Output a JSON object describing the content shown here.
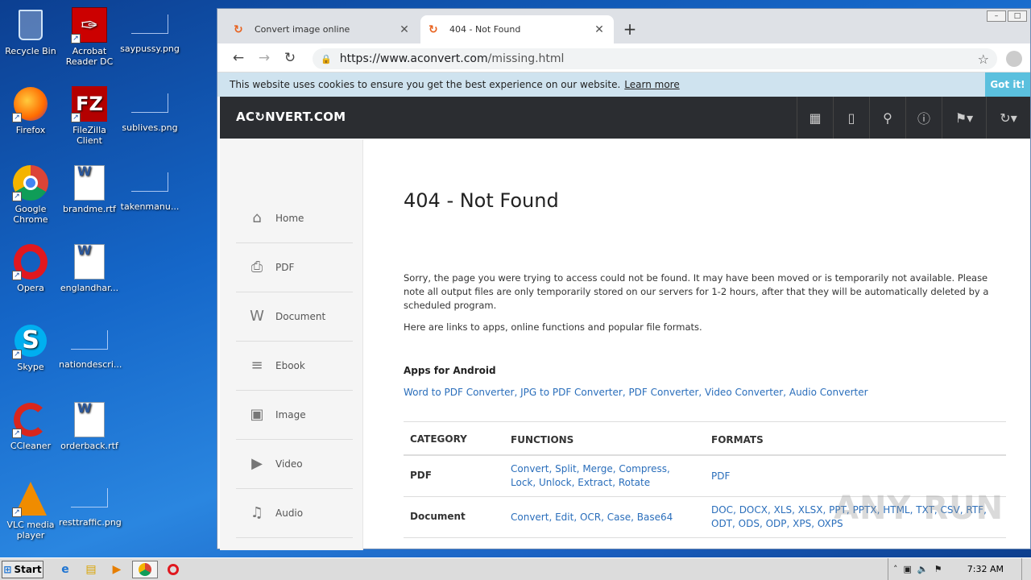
{
  "desktop": {
    "icons": [
      {
        "label": "Recycle Bin"
      },
      {
        "label": "Acrobat Reader DC"
      },
      {
        "label": "saypussy.png"
      },
      {
        "label": "Firefox"
      },
      {
        "label": "FileZilla Client"
      },
      {
        "label": "sublives.png"
      },
      {
        "label": "Google Chrome"
      },
      {
        "label": "brandme.rtf"
      },
      {
        "label": "takenmanu..."
      },
      {
        "label": "Opera"
      },
      {
        "label": "englandhar..."
      },
      {
        "label": "Skype"
      },
      {
        "label": "nationdescri..."
      },
      {
        "label": "CCleaner"
      },
      {
        "label": "orderback.rtf"
      },
      {
        "label": "VLC media player"
      },
      {
        "label": "resttraffic.png"
      }
    ]
  },
  "browser": {
    "tabs": [
      {
        "title": "Convert image online"
      },
      {
        "title": "404 - Not Found"
      }
    ],
    "url_domain": "https://www.aconvert.com",
    "url_path": "/missing.html"
  },
  "cookie_bar": {
    "text": "This website uses cookies to ensure you get the best experience on our website.",
    "learn_more": "Learn more",
    "button": "Got it!"
  },
  "site": {
    "logo": "AC↻NVERT.COM",
    "sidebar": [
      {
        "label": "Home",
        "icon": "⌂"
      },
      {
        "label": "PDF",
        "icon": "⎙"
      },
      {
        "label": "Document",
        "icon": "W"
      },
      {
        "label": "Ebook",
        "icon": "≡"
      },
      {
        "label": "Image",
        "icon": "▣"
      },
      {
        "label": "Video",
        "icon": "▶"
      },
      {
        "label": "Audio",
        "icon": "♫"
      }
    ],
    "page_title": "404 - Not Found",
    "intro": "Sorry, the page you were trying to access could not be found. It may have been moved or is temporarily not available. Please note all output files are only temporarily stored on our servers for 1-2 hours, after that they will be automatically deleted by a scheduled program.",
    "links_intro": "Here are links to apps, online functions and popular file formats.",
    "apps_heading": "Apps for Android",
    "apps_links": "Word to PDF Converter, JPG to PDF Converter, PDF Converter, Video Converter, Audio Converter",
    "table": {
      "headers": [
        "CATEGORY",
        "FUNCTIONS",
        "FORMATS"
      ],
      "rows": [
        {
          "category": "PDF",
          "functions": "Convert, Split, Merge, Compress, Lock, Unlock, Extract, Rotate",
          "formats": "PDF"
        },
        {
          "category": "Document",
          "functions": "Convert, Edit, OCR, Case, Base64",
          "formats": "DOC, DOCX, XLS, XLSX, PPT, PPTX, HTML, TXT, CSV, RTF, ODT, ODS, ODP, XPS, OXPS"
        }
      ]
    }
  },
  "watermark": "ANY RUN",
  "taskbar": {
    "start": "Start",
    "clock": "7:32 AM"
  }
}
